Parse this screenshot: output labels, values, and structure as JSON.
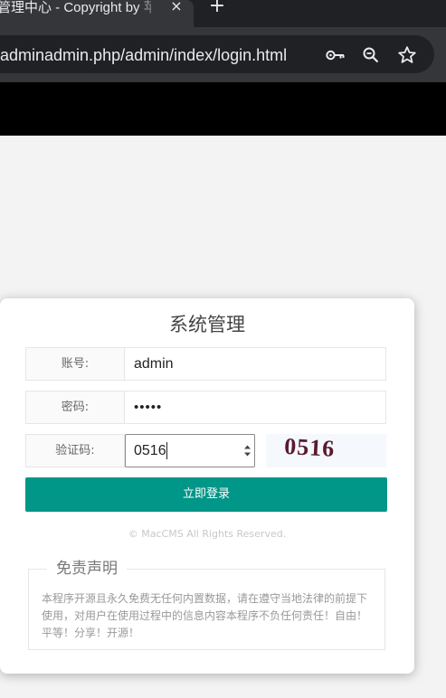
{
  "browser": {
    "tab_title": "管理中心 - Copyright by 苹",
    "tab_close": "×",
    "new_tab": "+",
    "url": "adminadmin.php/admin/index/login.html",
    "icons": [
      "key-icon",
      "zoom-icon",
      "star-icon"
    ]
  },
  "login": {
    "title": "系统管理",
    "account_label": "账号:",
    "account_value": "admin",
    "password_label": "密码:",
    "password_value": "•••••",
    "captcha_label": "验证码:",
    "captcha_value": "0516",
    "captcha_image_text": "0516",
    "submit_label": "立即登录",
    "copyright": "© MacCMS All Rights Reserved."
  },
  "disclaimer": {
    "title": "免责声明",
    "text": "本程序开源且永久免费无任何内置数据，请在遵守当地法律的前提下使用，对用户在使用过程中的信息内容本程序不负任何责任！自由！平等！分享！开源！"
  },
  "colors": {
    "accent": "#009688",
    "captcha_text": "#5a1a2e"
  }
}
